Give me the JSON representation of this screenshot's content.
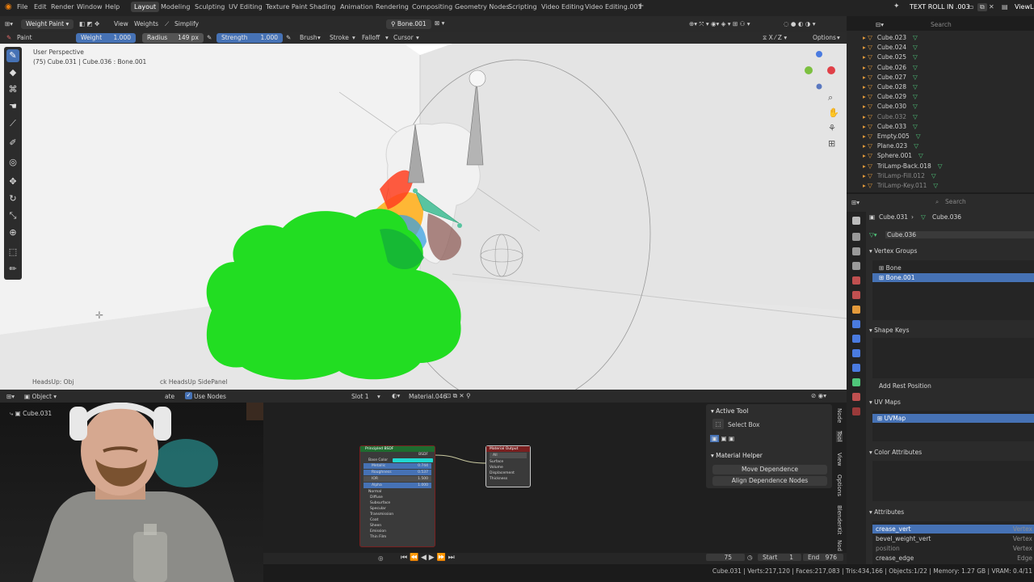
{
  "topbar": {
    "menus": [
      "File",
      "Edit",
      "Render",
      "Window",
      "Help"
    ],
    "workspaces": [
      "Layout",
      "Modeling",
      "Sculpting",
      "UV Editing",
      "Texture Paint",
      "Shading",
      "Animation",
      "Rendering",
      "Compositing",
      "Geometry Nodes",
      "Scripting",
      "Video Editing",
      "Video Editing.001"
    ],
    "add_tab": "+",
    "scene_name": "TEXT ROLL IN .003",
    "view_layer": "ViewL"
  },
  "viewport_header": {
    "mode": "Weight Paint",
    "menus": [
      "View",
      "Weights"
    ],
    "simplify": "Simplify",
    "bone": "Bone.001",
    "options": "Options"
  },
  "tool_settings": {
    "paint": "Paint",
    "weight_label": "Weight",
    "weight_value": "1.000",
    "radius_label": "Radius",
    "radius_value": "149 px",
    "strength_label": "Strength",
    "strength_value": "1.000",
    "brush": "Brush",
    "stroke": "Stroke",
    "falloff": "Falloff",
    "cursor": "Cursor"
  },
  "viewport": {
    "perspective": "User Perspective",
    "object_info": "(75) Cube.031 | Cube.036 : Bone.001",
    "heads_up_left": "HeadsUp: Obj",
    "heads_up_right": "ck HeadsUp SidePanel"
  },
  "outliner": {
    "search_placeholder": "Search",
    "items": [
      {
        "name": "Cube.023",
        "dim": false
      },
      {
        "name": "Cube.024",
        "dim": false
      },
      {
        "name": "Cube.025",
        "dim": false
      },
      {
        "name": "Cube.026",
        "dim": false
      },
      {
        "name": "Cube.027",
        "dim": false
      },
      {
        "name": "Cube.028",
        "dim": false
      },
      {
        "name": "Cube.029",
        "dim": false
      },
      {
        "name": "Cube.030",
        "dim": false
      },
      {
        "name": "Cube.032",
        "dim": true
      },
      {
        "name": "Cube.033",
        "dim": false
      },
      {
        "name": "Empty.005",
        "dim": false
      },
      {
        "name": "Plane.023",
        "dim": false
      },
      {
        "name": "Sphere.001",
        "dim": false
      },
      {
        "name": "TriLamp-Back.018",
        "dim": false
      },
      {
        "name": "TriLamp-Fill.012",
        "dim": true
      },
      {
        "name": "TriLamp-Key.011",
        "dim": true
      }
    ]
  },
  "properties": {
    "search_placeholder": "Search",
    "breadcrumb_object": "Cube.031",
    "breadcrumb_mesh": "Cube.036",
    "mesh_name": "Cube.036",
    "vertex_groups_title": "Vertex Groups",
    "vertex_groups": [
      "Bone",
      "Bone.001"
    ],
    "shape_keys_title": "Shape Keys",
    "add_rest_position": "Add Rest Position",
    "uv_maps_title": "UV Maps",
    "uv_map": "UVMap",
    "color_attributes_title": "Color Attributes",
    "attributes_title": "Attributes",
    "attributes": [
      {
        "name": "crease_vert",
        "domain": "Vertex"
      },
      {
        "name": "bevel_weight_vert",
        "domain": "Vertex"
      },
      {
        "name": "position",
        "domain": "Vertex"
      },
      {
        "name": "crease_edge",
        "domain": "Edge"
      }
    ]
  },
  "node_editor": {
    "editor_type": "Object",
    "use_nodes_partial": "ate",
    "use_nodes": "Use Nodes",
    "slot": "Slot 1",
    "material": "Material.046",
    "object": "Cube.031",
    "principled": {
      "title": "Principled BSDF",
      "output": "BSDF",
      "rows": [
        "Base Color",
        "Metallic",
        "Roughness",
        "IOR",
        "Alpha",
        "Normal",
        "Diffuse",
        "Subsurface",
        "Specular",
        "Transmission",
        "Coat",
        "Sheen",
        "Emission",
        "Thin Film"
      ],
      "values": [
        "",
        "0.744",
        "0.537",
        "1.500",
        "1.000"
      ]
    },
    "material_output": {
      "title": "Material Output",
      "target": "All",
      "rows": [
        "Surface",
        "Volume",
        "Displacement",
        "Thickness"
      ]
    }
  },
  "n_panel": {
    "active_tool_title": "Active Tool",
    "tool_name": "Select Box",
    "material_helper_title": "Material Helper",
    "move_dependence": "Move Dependence",
    "align_dependence": "Align Dependence Nodes",
    "tabs": [
      "Node",
      "Tool",
      "View",
      "Options",
      "BlenderKit",
      "Nod"
    ]
  },
  "timeline": {
    "current_frame": "75",
    "start_label": "Start",
    "start_value": "1",
    "end_label": "End",
    "end_value": "976"
  },
  "statusbar": {
    "stats": "Cube.031 | Verts:217,120 | Faces:217,083 | Tris:434,166 | Objects:1/22 | Memory: 1.27 GB | VRAM: 0.4/11"
  },
  "colors": {
    "accent": "#4672b5",
    "weight_green": "#22dd22",
    "vertex_group_green": "#4fc67a",
    "object_orange": "#e39a3b"
  }
}
